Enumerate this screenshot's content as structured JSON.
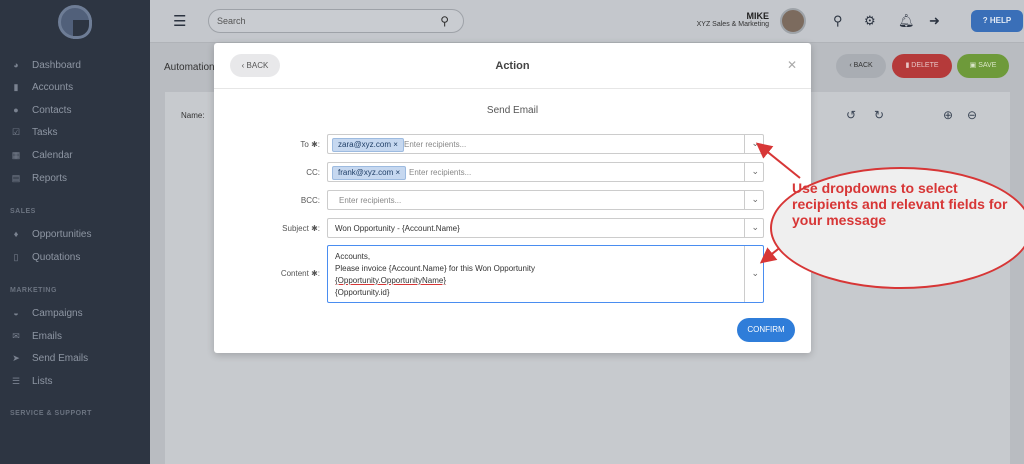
{
  "sidebar": {
    "items": [
      {
        "label": "Dashboard",
        "icon": "dashboard-icon"
      },
      {
        "label": "Accounts",
        "icon": "accounts-icon"
      },
      {
        "label": "Contacts",
        "icon": "contacts-icon"
      },
      {
        "label": "Tasks",
        "icon": "tasks-icon"
      },
      {
        "label": "Calendar",
        "icon": "calendar-icon"
      },
      {
        "label": "Reports",
        "icon": "reports-icon"
      }
    ],
    "sections": [
      {
        "title": "SALES",
        "items": [
          {
            "label": "Opportunities",
            "icon": "bulb-icon"
          },
          {
            "label": "Quotations",
            "icon": "document-icon"
          }
        ]
      },
      {
        "title": "MARKETING",
        "items": [
          {
            "label": "Campaigns",
            "icon": "inbox-icon"
          },
          {
            "label": "Emails",
            "icon": "email-icon"
          },
          {
            "label": "Send Emails",
            "icon": "send-icon"
          },
          {
            "label": "Lists",
            "icon": "list-icon"
          }
        ]
      },
      {
        "title": "SERVICE & SUPPORT",
        "items": []
      }
    ]
  },
  "header": {
    "search_placeholder": "Search",
    "user_name": "MIKE",
    "company": "XYZ Sales & Marketing",
    "help_label": "HELP"
  },
  "background": {
    "page_title": "Automation",
    "name_label": "Name:",
    "back_label": "BACK",
    "delete_label": "DELETE",
    "save_label": "SAVE"
  },
  "modal": {
    "back_label": "BACK",
    "title": "Action",
    "subtitle": "Send Email",
    "to_label": "To",
    "to_chip": "zara@xyz.com",
    "to_placeholder": "Enter recipients...",
    "cc_label": "CC:",
    "cc_chip": "frank@xyz.com",
    "cc_placeholder": "Enter recipients...",
    "bcc_label": "BCC:",
    "bcc_placeholder": "Enter recipients...",
    "subject_label": "Subject",
    "subject_value": "Won Opportunity - {Account.Name}",
    "content_label": "Content",
    "content_lines": [
      "Accounts,",
      "Please invoice {Account.Name} for this Won Opportunity",
      "{Opportunity.OpportunityName}",
      "{Opportunity.id}"
    ],
    "confirm_label": "CONFIRM"
  },
  "callout": {
    "text": "Use dropdowns to select recipients and relevant fields for your message"
  },
  "colors": {
    "accent": "#2f7dd9",
    "delete": "#b53a3a",
    "save": "#6e9a3a",
    "callout": "#d73636"
  }
}
